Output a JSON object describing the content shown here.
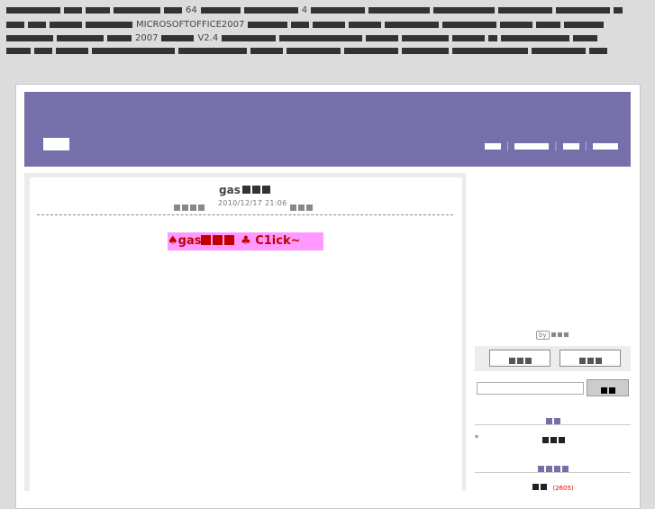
{
  "top_text": {
    "line1_num1": "64",
    "line1_num2": "4",
    "line2_product": "MICROSOFTOFFICE2007",
    "line3_year": "2007",
    "line3_version": "V2.4"
  },
  "post": {
    "title": "gas",
    "date": "2010/12/17 21:06"
  },
  "promo": {
    "prefix": "♠gas",
    "suffix": " ♣ C1ick~"
  },
  "sidebar": {
    "by_label": "by",
    "archive_count": "(2605)"
  },
  "colors": {
    "header": "#7670aa",
    "promo_bg": "#ff99ff",
    "promo_text": "#c00000"
  }
}
